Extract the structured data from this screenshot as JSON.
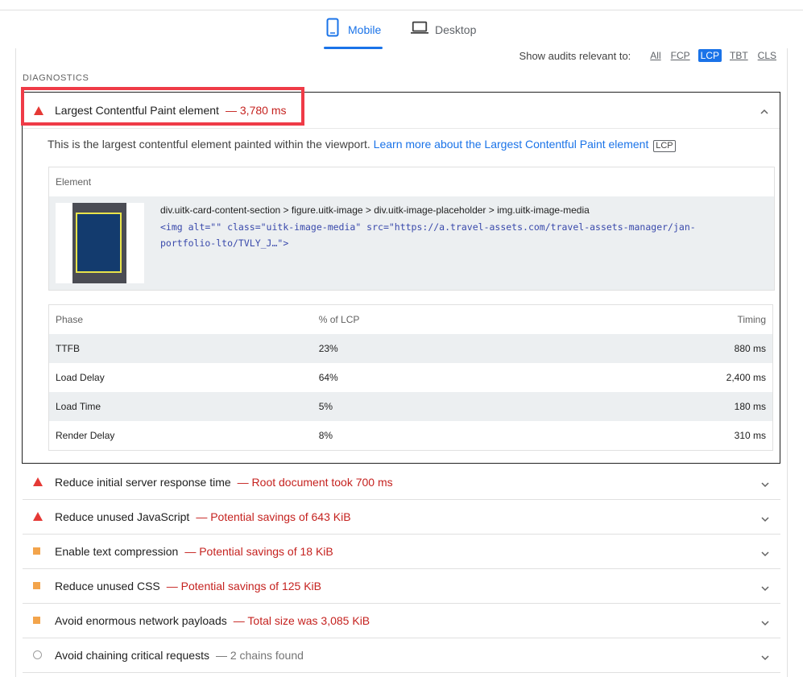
{
  "tabs": {
    "mobile": "Mobile",
    "desktop": "Desktop"
  },
  "filter": {
    "label": "Show audits relevant to:",
    "chips": [
      "All",
      "FCP",
      "LCP",
      "TBT",
      "CLS"
    ],
    "active": "LCP"
  },
  "section_title": "DIAGNOSTICS",
  "lcp_audit": {
    "title": "Largest Contentful Paint element",
    "detail": "— 3,780 ms",
    "description": "This is the largest contentful element painted within the viewport.",
    "learn_more": "Learn more about the Largest Contentful Paint element",
    "badge": "LCP",
    "element_header": "Element",
    "selector": "div.uitk-card-content-section > figure.uitk-image > div.uitk-image-placeholder > img.uitk-image-media",
    "snippet_line1": "<img alt=\"\" class=\"uitk-image-media\" src=\"https://a.travel-assets.com/travel-assets-manager/jan-",
    "snippet_line2": "portfolio-lto/TVLY_J…\">",
    "phase_headers": {
      "phase": "Phase",
      "pct": "% of LCP",
      "timing": "Timing"
    },
    "phases": [
      {
        "phase": "TTFB",
        "pct": "23%",
        "timing": "880 ms"
      },
      {
        "phase": "Load Delay",
        "pct": "64%",
        "timing": "2,400 ms"
      },
      {
        "phase": "Load Time",
        "pct": "5%",
        "timing": "180 ms"
      },
      {
        "phase": "Render Delay",
        "pct": "8%",
        "timing": "310 ms"
      }
    ]
  },
  "audits": [
    {
      "title": "Reduce initial server response time",
      "detail": "— Root document took 700 ms",
      "severity": "fail"
    },
    {
      "title": "Reduce unused JavaScript",
      "detail": "— Potential savings of 643 KiB",
      "severity": "fail"
    },
    {
      "title": "Enable text compression",
      "detail": "— Potential savings of 18 KiB",
      "severity": "average"
    },
    {
      "title": "Reduce unused CSS",
      "detail": "— Potential savings of 125 KiB",
      "severity": "average"
    },
    {
      "title": "Avoid enormous network payloads",
      "detail": "— Total size was 3,085 KiB",
      "severity": "average"
    },
    {
      "title": "Avoid chaining critical requests",
      "detail": "— 2 chains found",
      "severity": "info"
    }
  ],
  "colors": {
    "accent": "#1a73e8",
    "fail": "#e53935",
    "average": "#f3a44b",
    "highlight_box": "#ef3b47"
  }
}
